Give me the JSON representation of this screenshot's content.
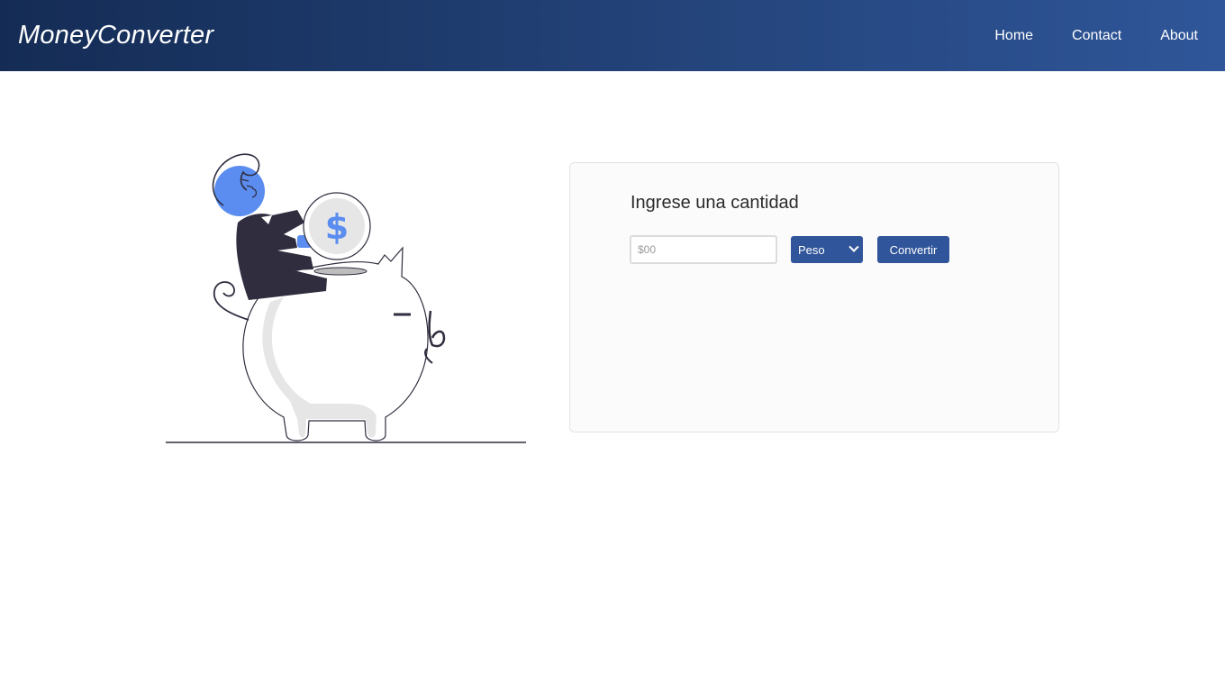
{
  "navbar": {
    "brand": "MoneyConverter",
    "links": [
      "Home",
      "Contact",
      "About"
    ]
  },
  "converter": {
    "title": "Ingrese una cantidad",
    "amount_placeholder": "$00",
    "currency_selected": "Peso",
    "convert_label": "Convertir"
  },
  "illustration": {
    "coin_symbol": "$"
  },
  "colors": {
    "navbar_start": "#142c55",
    "navbar_end": "#2f5699",
    "accent": "#31559a",
    "illustration_blue": "#5b8df0",
    "illustration_dark": "#2f2d3e"
  }
}
